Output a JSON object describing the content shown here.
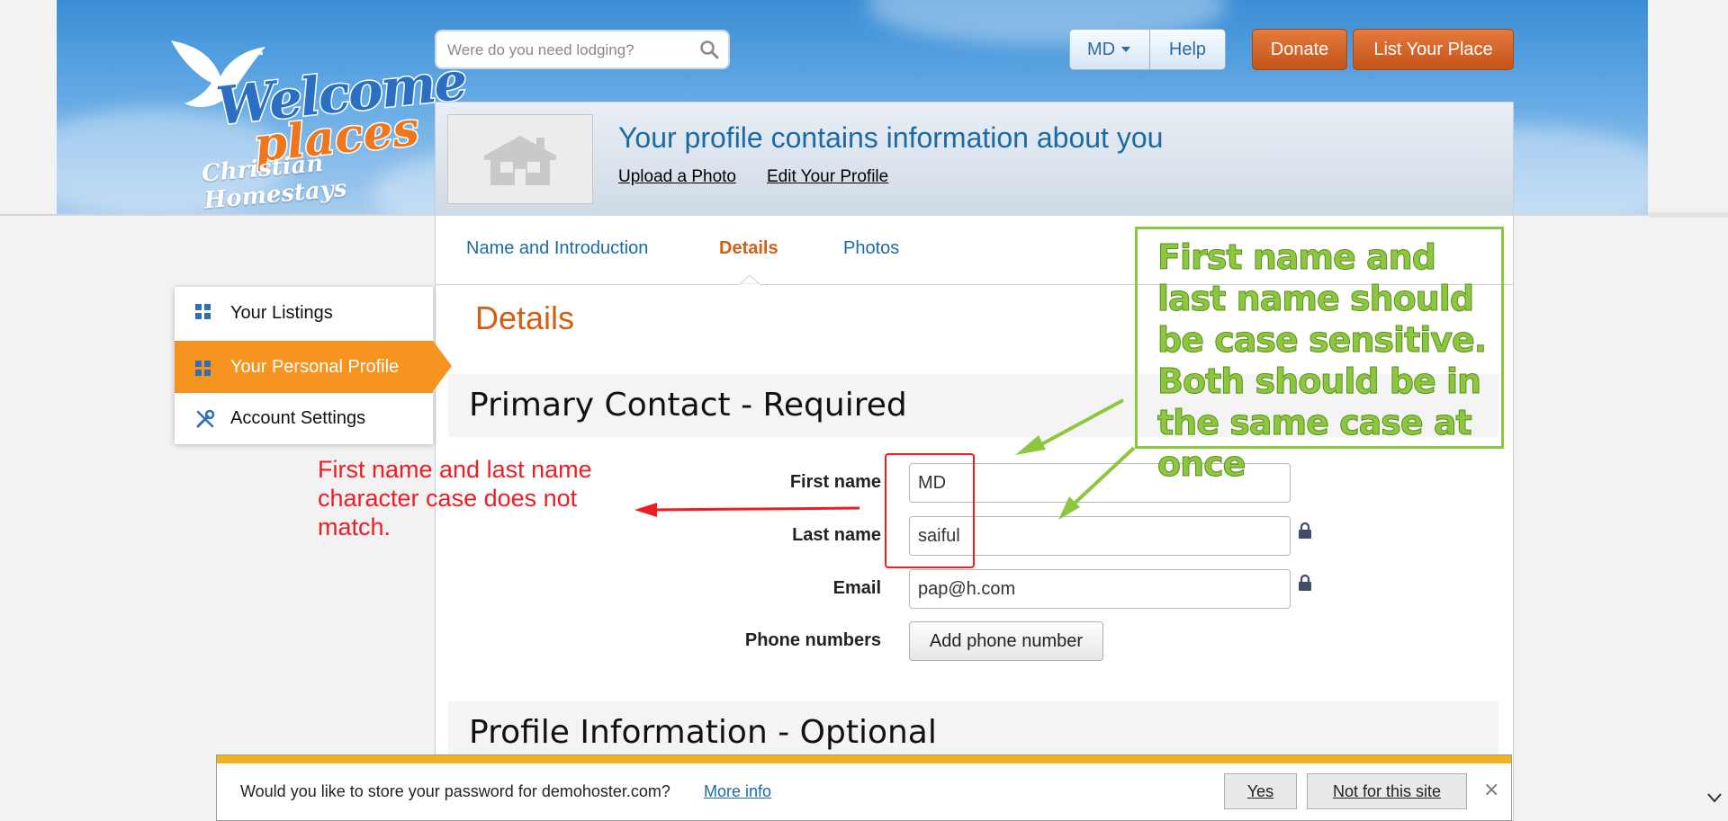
{
  "brand": {
    "logo_line1": "Welcome",
    "logo_line2": "places",
    "logo_tagline": "Christian Homestays"
  },
  "search": {
    "placeholder": "Were do you need lodging?"
  },
  "topnav": {
    "user_label": "MD",
    "help_label": "Help",
    "donate_label": "Donate",
    "list_place_label": "List Your Place"
  },
  "profile_header": {
    "title": "Your profile contains information about you",
    "upload_link": "Upload a Photo",
    "edit_link": "Edit Your Profile"
  },
  "tabs": [
    {
      "label": "Name and Introduction",
      "active": false
    },
    {
      "label": "Details",
      "active": true
    },
    {
      "label": "Photos",
      "active": false
    }
  ],
  "details_heading": "Details",
  "primary_section": {
    "title": "Primary Contact - Required",
    "fields": {
      "first_name": {
        "label": "First name",
        "value": "MD"
      },
      "last_name": {
        "label": "Last name",
        "value": "saiful"
      },
      "email": {
        "label": "Email",
        "value": "pap@h.com"
      },
      "phone": {
        "label": "Phone numbers",
        "button_label": "Add phone number"
      }
    }
  },
  "optional_section": {
    "title": "Profile Information - Optional"
  },
  "sidebar": {
    "items": [
      {
        "label": "Your Listings",
        "icon": "grid-icon",
        "active": false
      },
      {
        "label": "Your Personal Profile",
        "icon": "grid-icon",
        "active": true
      },
      {
        "label": "Account Settings",
        "icon": "tools-icon",
        "active": false
      }
    ]
  },
  "annotations": {
    "red_note": "First name and last name character case does not match.",
    "green_note": "First name and last name  should be case sensitive. Both should be in the same case at once"
  },
  "password_bar": {
    "message": "Would you like to store your password for demohoster.com?",
    "more_info": "More info",
    "yes_label": "Yes",
    "not_label": "Not for this site",
    "close_label": "×"
  },
  "colors": {
    "accent_orange": "#f69420",
    "link_blue": "#1a6aa8",
    "annotation_red": "#ee1c24",
    "annotation_green": "#8dc63f"
  }
}
